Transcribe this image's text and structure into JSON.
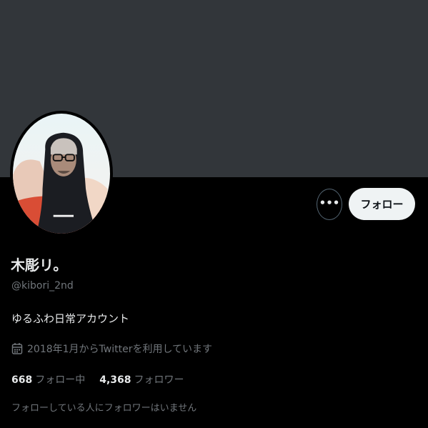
{
  "colors": {
    "banner": "#32363a",
    "background": "#000000",
    "primary_text": "#e7e9ea",
    "secondary_text": "#71767b",
    "follow_button_bg": "#eff3f4",
    "follow_button_text": "#0f1419"
  },
  "profile": {
    "display_name": "木彫リ。",
    "handle": "@kibori_2nd",
    "bio": "ゆるふわ日常アカウント",
    "joined": "2018年1月からTwitterを利用しています",
    "joined_icon": "calendar-icon"
  },
  "actions": {
    "more_label": "•••",
    "more_icon": "more-options-icon",
    "follow_label": "フォロー"
  },
  "stats": {
    "following_count": "668",
    "following_label": "フォロー中",
    "followers_count": "4,368",
    "followers_label": "フォロワー"
  },
  "followers_you_know": "フォローしている人にフォロワーはいません"
}
